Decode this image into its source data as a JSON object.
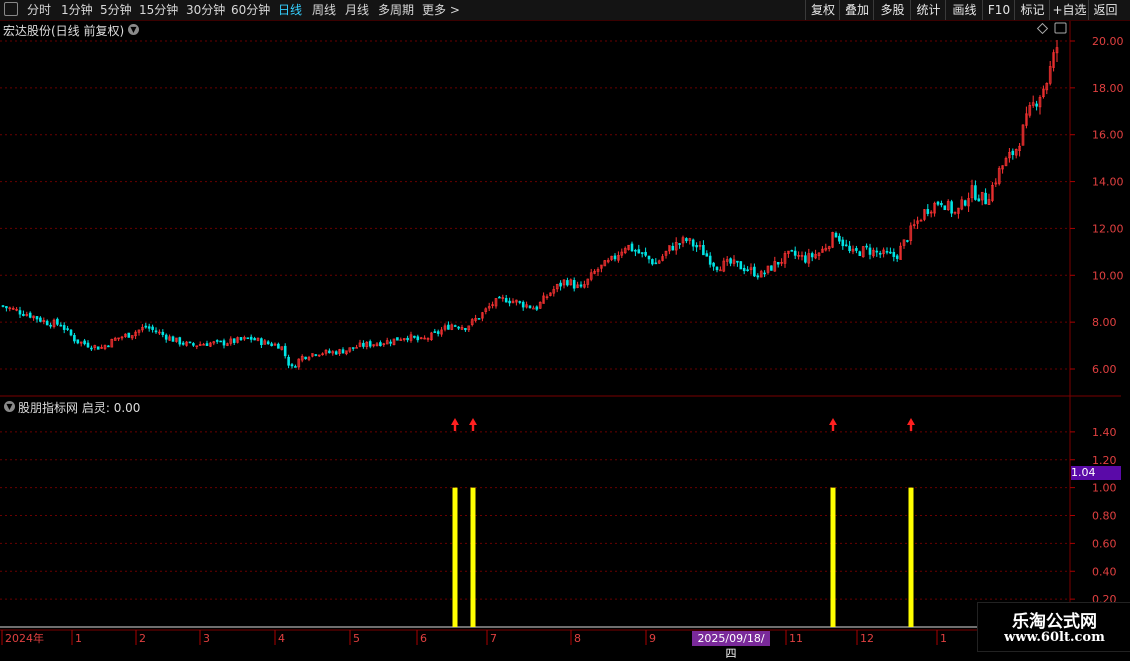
{
  "toolbar": {
    "periods": [
      {
        "label": "分时",
        "active": false
      },
      {
        "label": "1分钟",
        "active": false
      },
      {
        "label": "5分钟",
        "active": false
      },
      {
        "label": "15分钟",
        "active": false
      },
      {
        "label": "30分钟",
        "active": false
      },
      {
        "label": "60分钟",
        "active": false
      },
      {
        "label": "日线",
        "active": true
      },
      {
        "label": "周线",
        "active": false
      },
      {
        "label": "月线",
        "active": false
      },
      {
        "label": "多周期",
        "active": false
      },
      {
        "label": "更多 >",
        "active": false
      }
    ],
    "right_buttons": [
      "复权",
      "叠加",
      "多股",
      "统计",
      "画线",
      "F10",
      "标记",
      "+自选",
      "返回"
    ]
  },
  "main_chart": {
    "title": "宏达股份(日线 前复权)",
    "y_ticks": [
      "20.00",
      "18.00",
      "16.00",
      "14.00",
      "12.00",
      "10.00",
      "8.00",
      "6.00"
    ],
    "y_values": [
      20,
      18,
      16,
      14,
      12,
      10,
      8,
      6
    ],
    "up_color": "#ff3333",
    "down_color": "#00e5e5"
  },
  "indicator": {
    "name": "股朋指标网",
    "series_label": "启灵:",
    "series_value": "0.00",
    "y_ticks": [
      "1.40",
      "1.20",
      "1.00",
      "0.80",
      "0.60",
      "0.40",
      "0.20"
    ],
    "y_values": [
      1.4,
      1.2,
      1.0,
      0.8,
      0.6,
      0.4,
      0.2
    ],
    "current_value": "1.04",
    "bar_color": "#ffff00",
    "arrow_color": "#ff2020"
  },
  "date_axis": {
    "labels": [
      "2024年",
      "1",
      "2",
      "3",
      "4",
      "5",
      "6",
      "7",
      "8",
      "9",
      "11",
      "12",
      "1"
    ],
    "selected_date": "2025/09/18/四"
  },
  "watermark": {
    "title": "乐淘公式网",
    "url": "www.60lt.com"
  },
  "chart_data": [
    {
      "type": "candlestick",
      "title": "宏达股份(日线 前复权)",
      "ylim": [
        5.5,
        20.5
      ],
      "points": [
        [
          0,
          8.7
        ],
        [
          15,
          8.5
        ],
        [
          30,
          8.3
        ],
        [
          45,
          8.0
        ],
        [
          60,
          7.9
        ],
        [
          75,
          7.2
        ],
        [
          90,
          7.0
        ],
        [
          100,
          6.9
        ],
        [
          115,
          7.3
        ],
        [
          130,
          7.5
        ],
        [
          145,
          7.8
        ],
        [
          160,
          7.5
        ],
        [
          175,
          7.2
        ],
        [
          190,
          7.0
        ],
        [
          205,
          7.1
        ],
        [
          220,
          7.1
        ],
        [
          235,
          7.2
        ],
        [
          250,
          7.3
        ],
        [
          265,
          7.1
        ],
        [
          280,
          7.0
        ],
        [
          290,
          6.0
        ],
        [
          300,
          6.5
        ],
        [
          315,
          6.7
        ],
        [
          330,
          6.7
        ],
        [
          345,
          6.8
        ],
        [
          360,
          7.0
        ],
        [
          375,
          7.1
        ],
        [
          390,
          7.2
        ],
        [
          405,
          7.4
        ],
        [
          420,
          7.2
        ],
        [
          435,
          7.5
        ],
        [
          450,
          7.9
        ],
        [
          465,
          7.8
        ],
        [
          480,
          8.3
        ],
        [
          492,
          8.8
        ],
        [
          505,
          9.0
        ],
        [
          520,
          8.8
        ],
        [
          535,
          8.6
        ],
        [
          550,
          9.3
        ],
        [
          565,
          9.8
        ],
        [
          580,
          9.4
        ],
        [
          595,
          10.2
        ],
        [
          610,
          10.6
        ],
        [
          625,
          11.3
        ],
        [
          640,
          10.9
        ],
        [
          655,
          10.5
        ],
        [
          670,
          11.2
        ],
        [
          685,
          11.5
        ],
        [
          700,
          11.1
        ],
        [
          715,
          10.4
        ],
        [
          730,
          10.5
        ],
        [
          745,
          10.3
        ],
        [
          760,
          10.0
        ],
        [
          775,
          10.5
        ],
        [
          790,
          10.9
        ],
        [
          805,
          10.7
        ],
        [
          820,
          11.0
        ],
        [
          835,
          11.8
        ],
        [
          850,
          10.9
        ],
        [
          865,
          11.1
        ],
        [
          880,
          10.9
        ],
        [
          895,
          10.8
        ],
        [
          910,
          11.9
        ],
        [
          925,
          12.8
        ],
        [
          940,
          13.2
        ],
        [
          955,
          12.6
        ],
        [
          970,
          13.6
        ],
        [
          985,
          13.2
        ],
        [
          1000,
          14.6
        ],
        [
          1015,
          15.4
        ],
        [
          1030,
          17.1
        ],
        [
          1045,
          18.2
        ],
        [
          1057,
          19.9
        ]
      ]
    },
    {
      "type": "bar",
      "title": "股朋指标网",
      "series": [
        {
          "name": "启灵",
          "values": [
            1,
            1,
            1,
            1
          ]
        }
      ],
      "x": [
        455,
        473,
        833,
        911
      ],
      "ylim": [
        0,
        1.6
      ]
    }
  ]
}
